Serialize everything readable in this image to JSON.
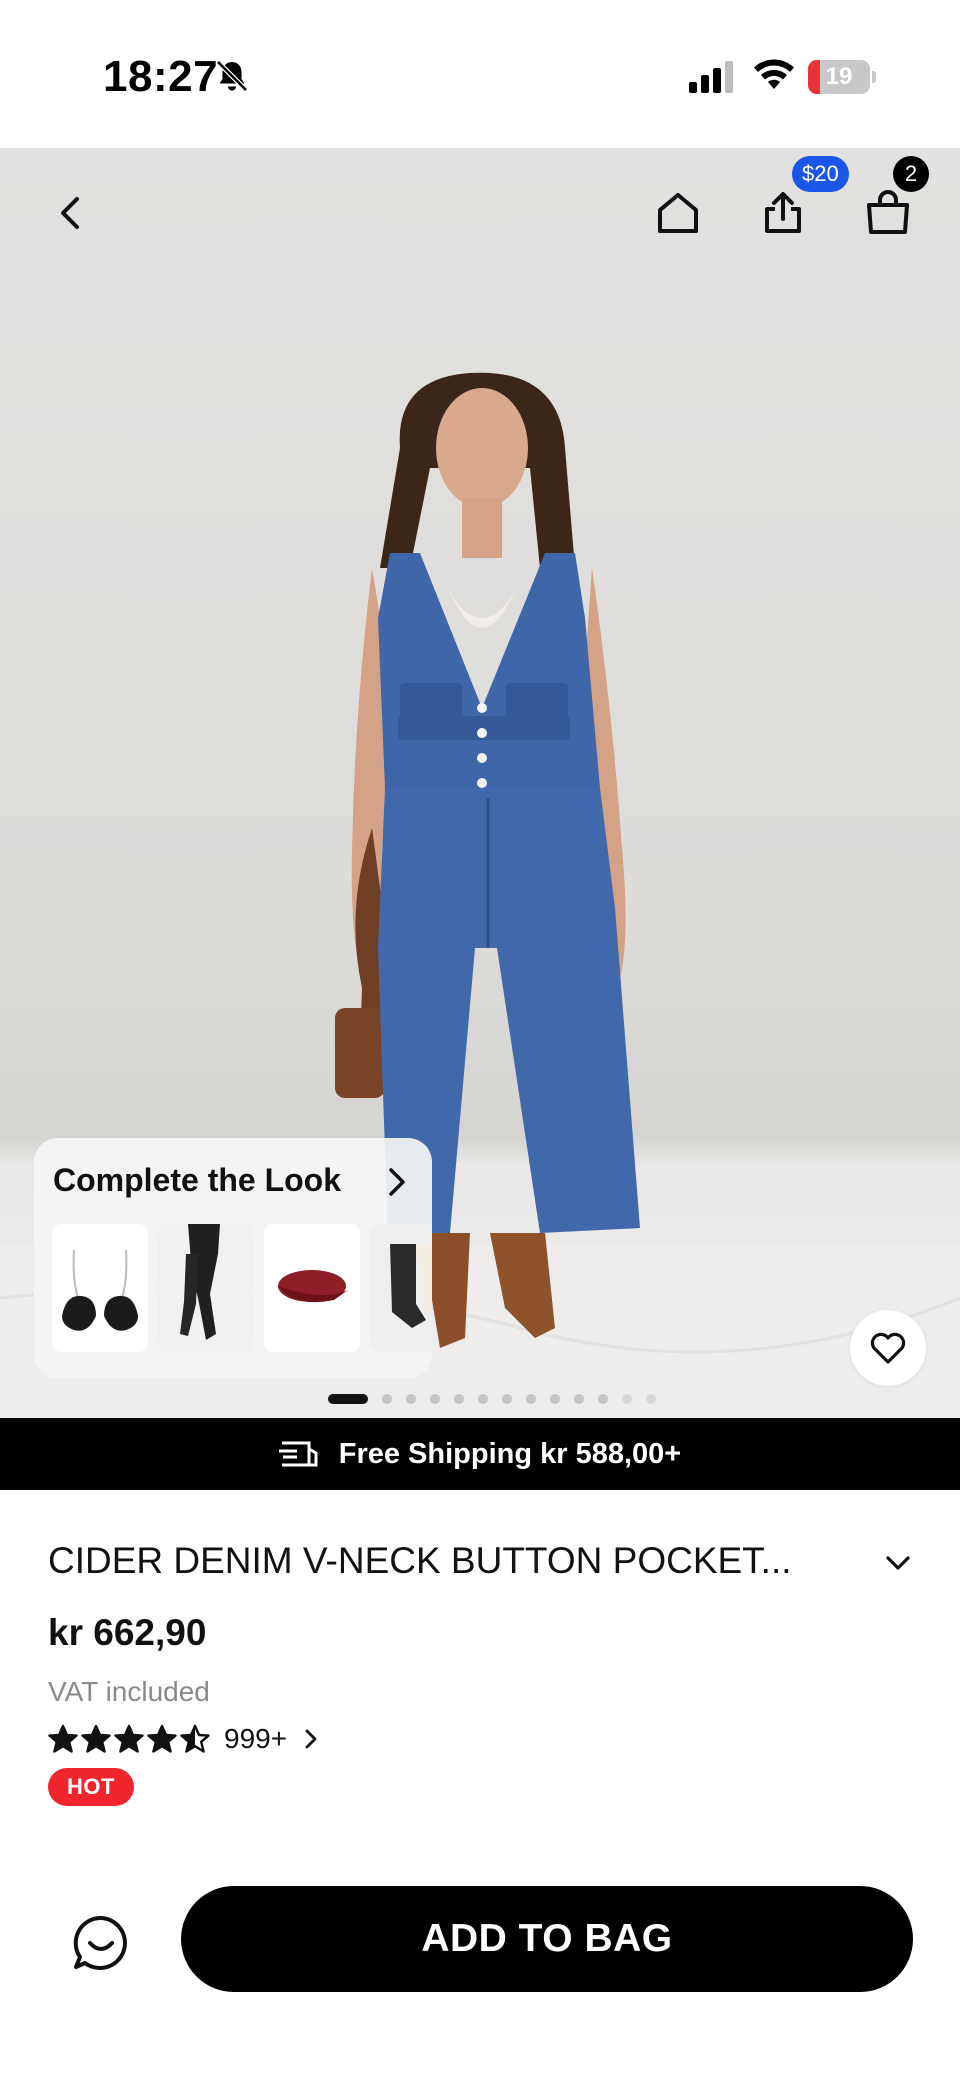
{
  "status_bar": {
    "time": "18:27",
    "battery_level": "19",
    "battery_fraction": 0.19,
    "icons": [
      "bell-slash-icon",
      "cellular-signal-icon",
      "wifi-icon",
      "battery-icon"
    ]
  },
  "header": {
    "icons": [
      "back-icon",
      "home-icon",
      "share-icon",
      "shopping-bag-icon"
    ],
    "share_badge": "$20",
    "bag_count": "2"
  },
  "complete_the_look": {
    "title": "Complete the Look",
    "items": [
      "bra-product",
      "tights-product",
      "beret-product",
      "socks-product"
    ]
  },
  "gallery": {
    "image_count": 13,
    "active_index": 0
  },
  "shipping_banner": {
    "icon": "shipping-truck-icon",
    "text": "Free Shipping kr 588,00+"
  },
  "product": {
    "title": "CIDER DENIM V-NECK BUTTON POCKET...",
    "price": "kr 662,90",
    "vat_note": "VAT included",
    "rating": 4.5,
    "rating_count": "999+",
    "badge": "HOT"
  },
  "bottom_bar": {
    "chat_icon": "chat-icon",
    "add_to_bag_label": "ADD TO BAG"
  },
  "colors": {
    "accent_badge_blue": "#1a56e8",
    "hot_red": "#f0252e",
    "battery_red": "#e8323a",
    "primary_black": "#000000"
  }
}
